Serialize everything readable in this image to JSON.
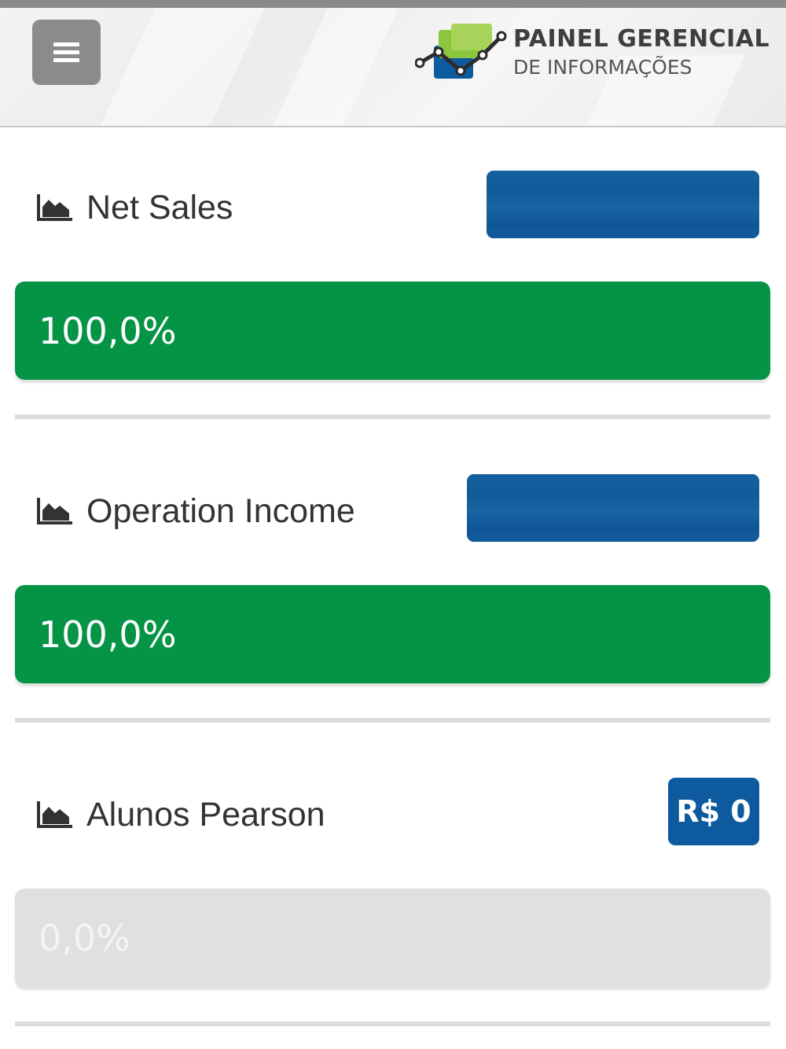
{
  "header": {
    "menu_icon": "hamburger-menu-icon",
    "logo": {
      "title": "PAINEL GERENCIAL",
      "subtitle": "DE INFORMAÇÕES",
      "icon": "chart-line-icon",
      "colors": {
        "green": "#8cc63f",
        "blue": "#0e5a9e",
        "dark": "#333333"
      }
    }
  },
  "kpis": [
    {
      "label": "Net Sales",
      "icon": "area-chart-icon",
      "badge_text": "",
      "progress_percent": 100,
      "progress_label": "100,0%",
      "bar_color": "#059346"
    },
    {
      "label": "Operation Income",
      "icon": "area-chart-icon",
      "badge_text": "",
      "progress_percent": 100,
      "progress_label": "100,0%",
      "bar_color": "#059346"
    },
    {
      "label": "Alunos Pearson",
      "icon": "area-chart-icon",
      "badge_text": "R$ 0",
      "progress_percent": 0,
      "progress_label": "0,0%",
      "bar_color": "#059346"
    }
  ],
  "colors": {
    "badge_blue": "#0e5a9e",
    "success_green": "#059346",
    "track_gray": "#e0e0e0",
    "menu_gray": "#8b8b8b"
  }
}
